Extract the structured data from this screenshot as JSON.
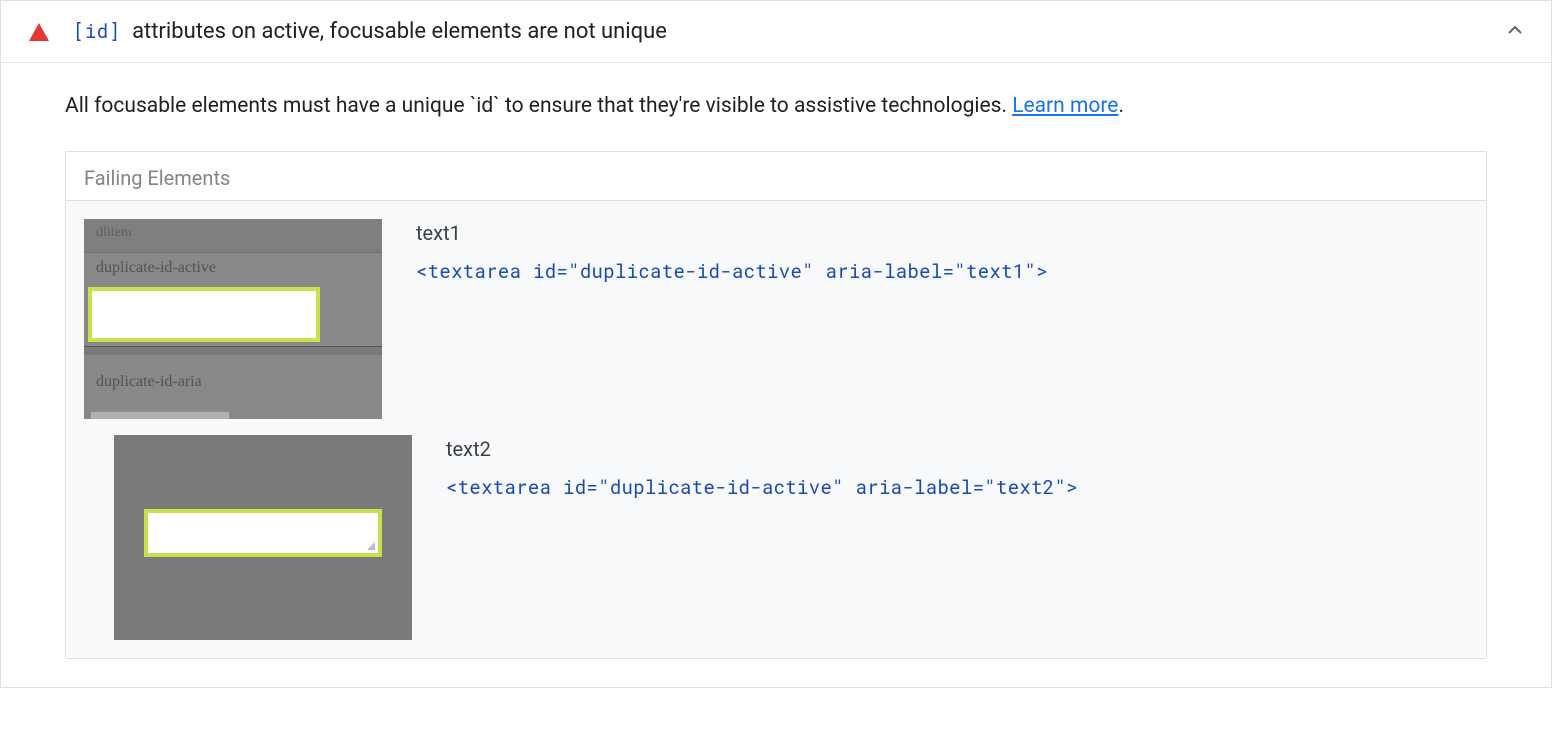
{
  "audit": {
    "code_attr": "[id]",
    "title_rest": " attributes on active, focusable elements are not unique",
    "description_prefix": "All focusable elements must have a unique `id` to ensure that they're visible to assistive technologies. ",
    "learn_more": "Learn more",
    "description_suffix": "."
  },
  "failing": {
    "header": "Failing Elements",
    "items": [
      {
        "label": "text1",
        "code": "<textarea id=\"duplicate-id-active\" aria-label=\"text1\">",
        "thumb": {
          "top_text": "dlitem",
          "row1_label": "duplicate-id-active",
          "row2_label": "duplicate-id-aria"
        }
      },
      {
        "label": "text2",
        "code": "<textarea id=\"duplicate-id-active\" aria-label=\"text2\">"
      }
    ]
  }
}
